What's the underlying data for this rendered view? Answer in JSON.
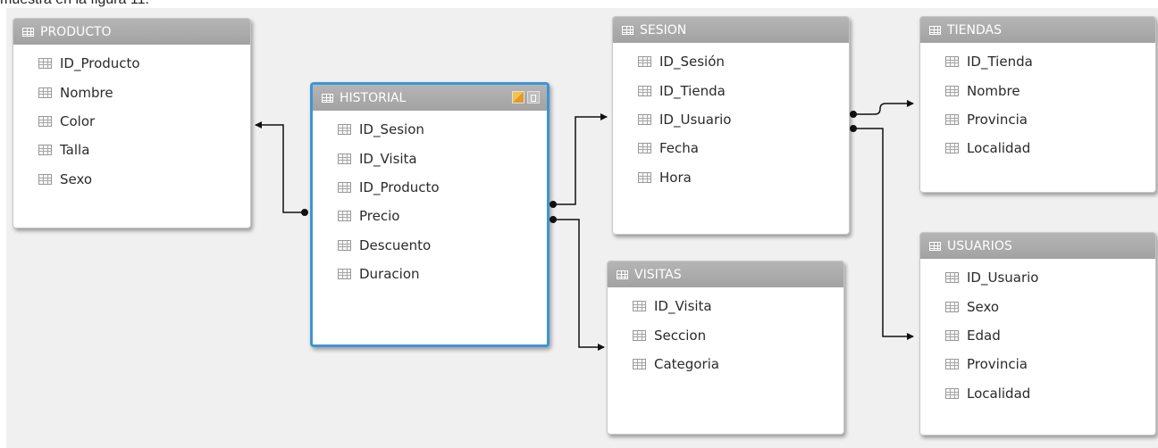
{
  "caption": "muestra en la figura 11.",
  "tables": {
    "producto": {
      "title": "PRODUCTO",
      "fields": [
        "ID_Producto",
        "Nombre",
        "Color",
        "Talla",
        "Sexo"
      ]
    },
    "historial": {
      "title": "HISTORIAL",
      "fields": [
        "ID_Sesion",
        "ID_Visita",
        "ID_Producto",
        "Precio",
        "Descuento",
        "Duracion"
      ]
    },
    "sesion": {
      "title": "SESION",
      "fields": [
        "ID_Sesión",
        "ID_Tienda",
        "ID_Usuario",
        "Fecha",
        "Hora"
      ]
    },
    "visitas": {
      "title": "VISITAS",
      "fields": [
        "ID_Visita",
        "Seccion",
        "Categoria"
      ]
    },
    "tiendas": {
      "title": "TIENDAS",
      "fields": [
        "ID_Tienda",
        "Nombre",
        "Provincia",
        "Localidad"
      ]
    },
    "usuarios": {
      "title": "USUARIOS",
      "fields": [
        "ID_Usuario",
        "Sexo",
        "Edad",
        "Provincia",
        "Localidad"
      ]
    }
  },
  "relationships": [
    {
      "from": "HISTORIAL",
      "to": "PRODUCTO"
    },
    {
      "from": "HISTORIAL",
      "to": "SESION"
    },
    {
      "from": "HISTORIAL",
      "to": "VISITAS"
    },
    {
      "from": "SESION",
      "to": "TIENDAS"
    },
    {
      "from": "SESION",
      "to": "USUARIOS"
    }
  ],
  "colors": {
    "header": "#a8a8a8",
    "selected_border": "#3d95d6",
    "canvas": "#f0f0f0"
  }
}
